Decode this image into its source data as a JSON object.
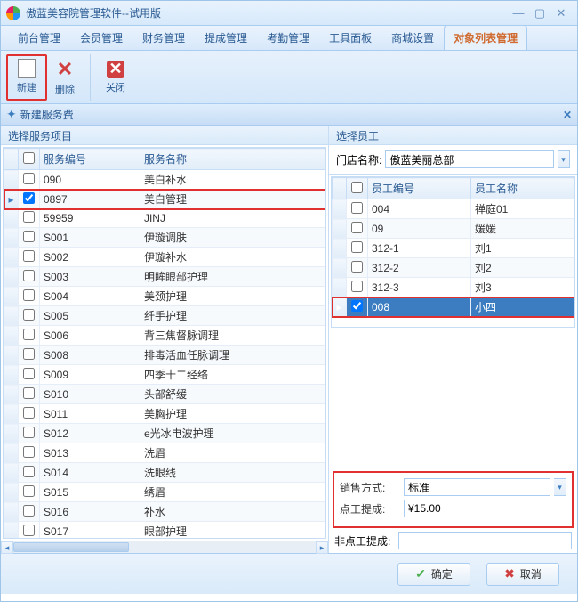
{
  "window": {
    "title": "傲蓝美容院管理软件--试用版"
  },
  "tabs": [
    "前台管理",
    "会员管理",
    "财务管理",
    "提成管理",
    "考勤管理",
    "工具面板",
    "商城设置",
    "对象列表管理"
  ],
  "active_tab": 7,
  "ribbon": {
    "new": "新建",
    "delete": "删除",
    "close": "关闭"
  },
  "panel": {
    "title": "新建服务费"
  },
  "left": {
    "section": "选择服务项目",
    "headers": {
      "code": "服务编号",
      "name": "服务名称"
    }
  },
  "services": [
    {
      "code": "090",
      "name": "美白补水",
      "checked": false,
      "sel": false
    },
    {
      "code": "0897",
      "name": "美白管理",
      "checked": true,
      "sel": true,
      "hl": true
    },
    {
      "code": "59959",
      "name": "JINJ",
      "checked": false,
      "sel": false
    },
    {
      "code": "S001",
      "name": "伊璇调肤",
      "checked": false,
      "sel": false
    },
    {
      "code": "S002",
      "name": "伊璇补水",
      "checked": false,
      "sel": false
    },
    {
      "code": "S003",
      "name": "明眸眼部护理",
      "checked": false,
      "sel": false
    },
    {
      "code": "S004",
      "name": "美颈护理",
      "checked": false,
      "sel": false
    },
    {
      "code": "S005",
      "name": "纤手护理",
      "checked": false,
      "sel": false
    },
    {
      "code": "S006",
      "name": "背三焦督脉调理",
      "checked": false,
      "sel": false
    },
    {
      "code": "S008",
      "name": "排毒活血任脉调理",
      "checked": false,
      "sel": false
    },
    {
      "code": "S009",
      "name": "四季十二经络",
      "checked": false,
      "sel": false
    },
    {
      "code": "S010",
      "name": "头部舒缓",
      "checked": false,
      "sel": false
    },
    {
      "code": "S011",
      "name": "美胸护理",
      "checked": false,
      "sel": false
    },
    {
      "code": "S012",
      "name": "e光冰电波护理",
      "checked": false,
      "sel": false
    },
    {
      "code": "S013",
      "name": "洗眉",
      "checked": false,
      "sel": false
    },
    {
      "code": "S014",
      "name": "洗眼线",
      "checked": false,
      "sel": false
    },
    {
      "code": "S015",
      "name": "绣眉",
      "checked": false,
      "sel": false
    },
    {
      "code": "S016",
      "name": "补水",
      "checked": false,
      "sel": false
    },
    {
      "code": "S017",
      "name": "眼部护理",
      "checked": false,
      "sel": false
    }
  ],
  "right": {
    "section": "选择员工",
    "store_label": "门店名称:",
    "store_value": "傲蓝美丽总部",
    "headers": {
      "code": "员工编号",
      "name": "员工名称"
    }
  },
  "employees": [
    {
      "code": "004",
      "name": "禅庭01",
      "checked": false,
      "sel": false
    },
    {
      "code": "09",
      "name": "媛媛",
      "checked": false,
      "sel": false
    },
    {
      "code": "312-1",
      "name": "刘1",
      "checked": false,
      "sel": false
    },
    {
      "code": "312-2",
      "name": "刘2",
      "checked": false,
      "sel": false
    },
    {
      "code": "312-3",
      "name": "刘3",
      "checked": false,
      "sel": false
    },
    {
      "code": "008",
      "name": "小四",
      "checked": true,
      "sel": true,
      "hl": true
    }
  ],
  "form": {
    "sale_mode_label": "销售方式:",
    "sale_mode_value": "标准",
    "commission_label": "点工提成:",
    "commission_value": "¥15.00",
    "non_commission_label": "非点工提成:",
    "non_commission_value": ""
  },
  "buttons": {
    "ok": "确定",
    "cancel": "取消"
  }
}
